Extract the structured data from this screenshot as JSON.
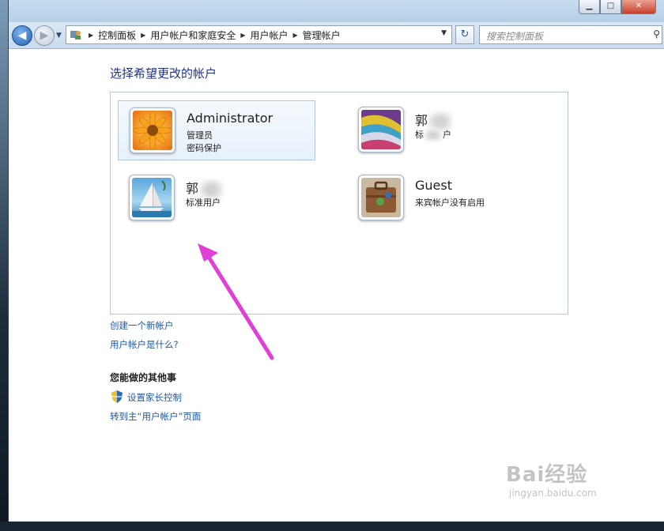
{
  "breadcrumb": [
    "控制面板",
    "用户帐户和家庭安全",
    "用户帐户",
    "管理帐户"
  ],
  "search": {
    "placeholder": "搜索控制面板"
  },
  "page": {
    "title": "选择希望更改的帐户"
  },
  "accounts": [
    {
      "name": "Administrator",
      "line1": "管理员",
      "line2": "密码保护",
      "avatar": "flower-icon",
      "selected": true
    },
    {
      "name": "郭",
      "line1": "标",
      "line2": "户",
      "avatar": "fabric-icon",
      "selected": false,
      "obscured": true
    },
    {
      "name": "郭",
      "line1": "标准用户",
      "line2": "",
      "avatar": "sailboat-icon",
      "selected": false,
      "obscured": true
    },
    {
      "name": "Guest",
      "line1": "来宾帐户没有启用",
      "line2": "",
      "avatar": "suitcase-icon",
      "selected": false
    }
  ],
  "links": {
    "create_account": "创建一个新帐户",
    "what_is_account": "用户帐户是什么?",
    "other_heading": "您能做的其他事",
    "parental": "设置家长控制",
    "goto_main": "转到主“用户帐户”页面"
  },
  "watermark": {
    "main": "Bai经验",
    "sub": "jingyan.baidu.com"
  },
  "colors": {
    "link": "#1e58a8",
    "title": "#1e3287",
    "arrow": "#e040d8"
  }
}
